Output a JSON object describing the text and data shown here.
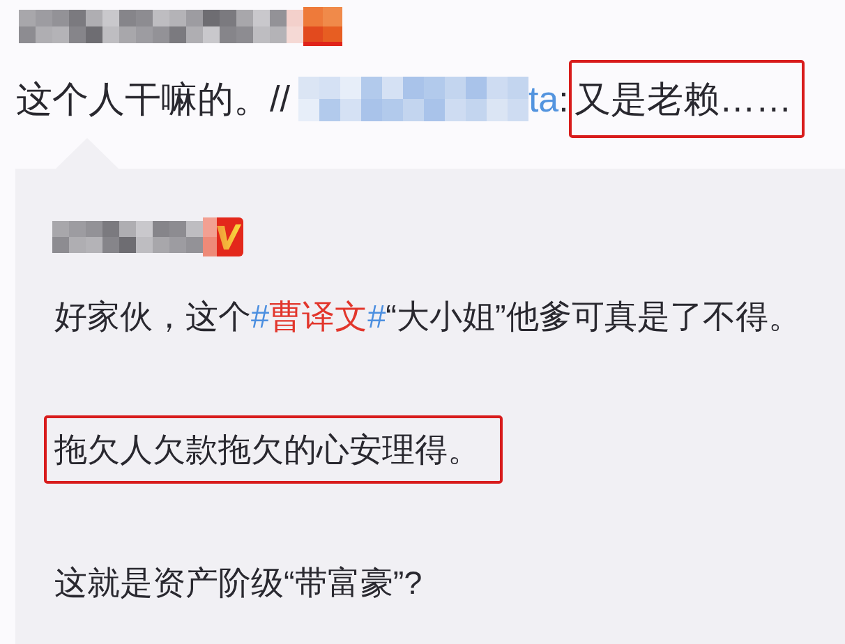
{
  "repost": {
    "author": {
      "name_redacted": true,
      "verified": true,
      "badge_pixelated": true
    },
    "comment": [
      {
        "kind": "text",
        "text": "这个人干嘛的。//",
        "highlighted": false
      },
      {
        "kind": "mention",
        "redacted": true,
        "text": "ta"
      },
      {
        "kind": "text",
        "text": ":",
        "highlighted": false
      },
      {
        "kind": "text",
        "text": "又是老赖……",
        "highlighted": true
      }
    ]
  },
  "quoted_post": {
    "author": {
      "name_redacted": true,
      "verified": true,
      "badge_pixelated": false
    },
    "paragraphs": [
      {
        "highlighted": false,
        "parts": [
          {
            "kind": "text",
            "text": "好家伙，这个"
          },
          {
            "kind": "hashtag",
            "parts": [
              {
                "kind": "hash",
                "text": "#"
              },
              {
                "kind": "topic",
                "text": "曹译文"
              },
              {
                "kind": "hash",
                "text": "#"
              }
            ]
          },
          {
            "kind": "text",
            "text": "“大小姐”他爹可真是了不得。"
          }
        ]
      },
      {
        "highlighted": true,
        "parts": [
          {
            "kind": "text",
            "text": "拖欠人欠款拖欠的心安理得。"
          }
        ]
      },
      {
        "highlighted": false,
        "parts": [
          {
            "kind": "text",
            "text": "这就是资产阶级“带富豪”?"
          }
        ]
      }
    ]
  }
}
